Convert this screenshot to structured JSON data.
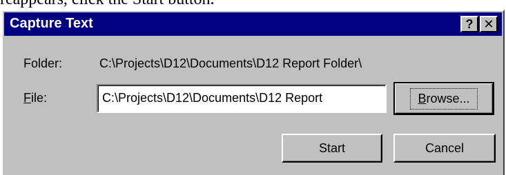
{
  "document": {
    "cut_off_text": "reappears, click the Start button."
  },
  "dialog": {
    "title": "Capture Text",
    "help_button": "?",
    "close_button": "✕",
    "folder_label": "Folder:",
    "folder_value": "C:\\Projects\\D12\\Documents\\D12 Report Folder\\",
    "file_label_mnemonic": "F",
    "file_label_rest": "ile:",
    "file_value": "C:\\Projects\\D12\\Documents\\D12 Report",
    "browse_mnemonic": "B",
    "browse_rest": "rowse...",
    "start_label": "Start",
    "cancel_label": "Cancel"
  },
  "colors": {
    "titlebar": "#000080",
    "dialog_face": "#c0c0c0"
  }
}
